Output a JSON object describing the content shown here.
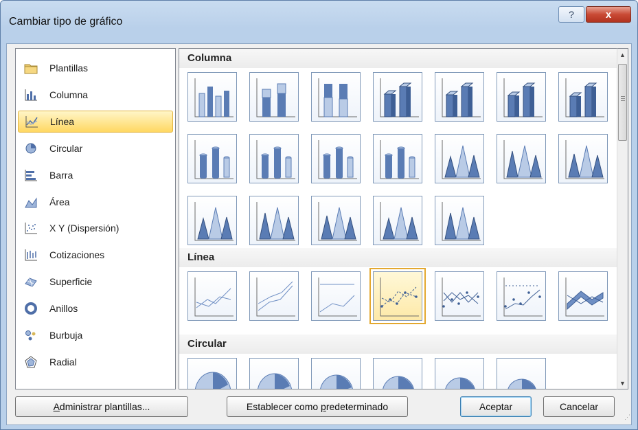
{
  "window": {
    "title": "Cambiar tipo de gráfico",
    "help_label": "?",
    "close_label": "x"
  },
  "chart_types": [
    {
      "label": "Plantillas",
      "icon": "folder-icon"
    },
    {
      "label": "Columna",
      "icon": "column-chart-icon"
    },
    {
      "label": "Línea",
      "icon": "line-chart-icon",
      "selected": true
    },
    {
      "label": "Circular",
      "icon": "pie-chart-icon"
    },
    {
      "label": "Barra",
      "icon": "bar-chart-icon"
    },
    {
      "label": "Área",
      "icon": "area-chart-icon"
    },
    {
      "label": "X Y (Dispersión)",
      "icon": "scatter-chart-icon"
    },
    {
      "label": "Cotizaciones",
      "icon": "stock-chart-icon"
    },
    {
      "label": "Superficie",
      "icon": "surface-chart-icon"
    },
    {
      "label": "Anillos",
      "icon": "doughnut-chart-icon"
    },
    {
      "label": "Burbuja",
      "icon": "bubble-chart-icon"
    },
    {
      "label": "Radial",
      "icon": "radar-chart-icon"
    }
  ],
  "gallery": {
    "sections": [
      {
        "title": "Columna",
        "count": 19
      },
      {
        "title": "Línea",
        "count": 7,
        "selected_index": 3
      },
      {
        "title": "Circular",
        "count": 6
      }
    ]
  },
  "buttons": {
    "manage_templates": {
      "prefix": "",
      "accel": "A",
      "rest": "dministrar plantillas..."
    },
    "set_default": {
      "prefix": "Establecer como ",
      "accel": "p",
      "rest": "redeterminado"
    },
    "ok": "Aceptar",
    "cancel": "Cancelar"
  },
  "colors": {
    "accent_selected": "#ffd862",
    "chart_blue": "#4f6fa8"
  }
}
